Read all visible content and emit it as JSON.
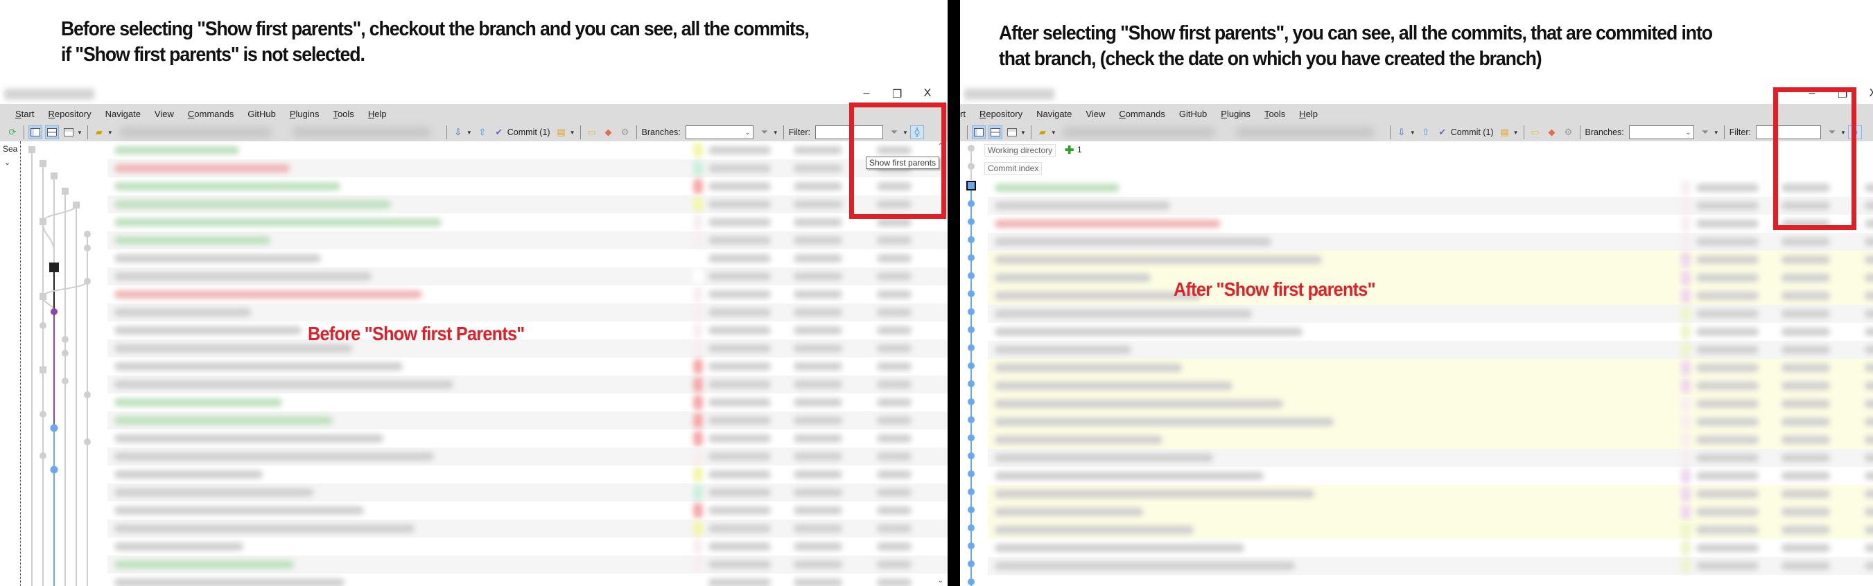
{
  "left": {
    "caption_line1": "Before selecting \"Show first parents\", checkout the branch and you can see, all the commits,",
    "caption_line2": "if \"Show first parents\" is not selected.",
    "annotation": "Before \"Show first Parents\"",
    "tooltip": "Show first parents",
    "sidebar_search_label": "Sea"
  },
  "right": {
    "caption_line1": "After selecting \"Show first parents\", you can see, all the commits, that are commited into",
    "caption_line2": "that branch, (check the date on which you have created the branch)",
    "annotation": "After \"Show first parents\"",
    "working_directory_label": "Working directory",
    "working_directory_count": "1",
    "commit_index_label": "Commit index"
  },
  "window_controls": {
    "minimize": "–",
    "restore": "❐",
    "close": "X"
  },
  "menu": {
    "items": [
      {
        "label": "Start",
        "accel": "S"
      },
      {
        "label": "Repository",
        "accel": "R"
      },
      {
        "label": "Navigate",
        "accel": ""
      },
      {
        "label": "View",
        "accel": ""
      },
      {
        "label": "Commands",
        "accel": "C"
      },
      {
        "label": "GitHub",
        "accel": ""
      },
      {
        "label": "Plugins",
        "accel": "P"
      },
      {
        "label": "Tools",
        "accel": "T"
      },
      {
        "label": "Help",
        "accel": "H"
      }
    ],
    "right_first_item_fragment": "rt"
  },
  "toolbar": {
    "commit_label": "Commit (1)",
    "branches_label": "Branches:",
    "filter_label": "Filter:",
    "branches_value": "",
    "filter_value": "",
    "icons": [
      "refresh-icon",
      "layout-left-icon",
      "layout-top-icon",
      "layout-bottom-icon",
      "open-repo-icon",
      "pull-icon",
      "push-icon",
      "commit-icon",
      "stash-icon",
      "folder-icon",
      "git-icon",
      "settings-icon",
      "branch-filter-icon",
      "text-filter-icon",
      "show-first-parents-icon"
    ]
  },
  "colors": {
    "annotation_red": "#e01f26",
    "graph_purple": "#8e44ad",
    "graph_blue": "#6aa8f0",
    "graph_gray": "#cfcfcf",
    "highlight_yellow": "#fdfde4"
  }
}
